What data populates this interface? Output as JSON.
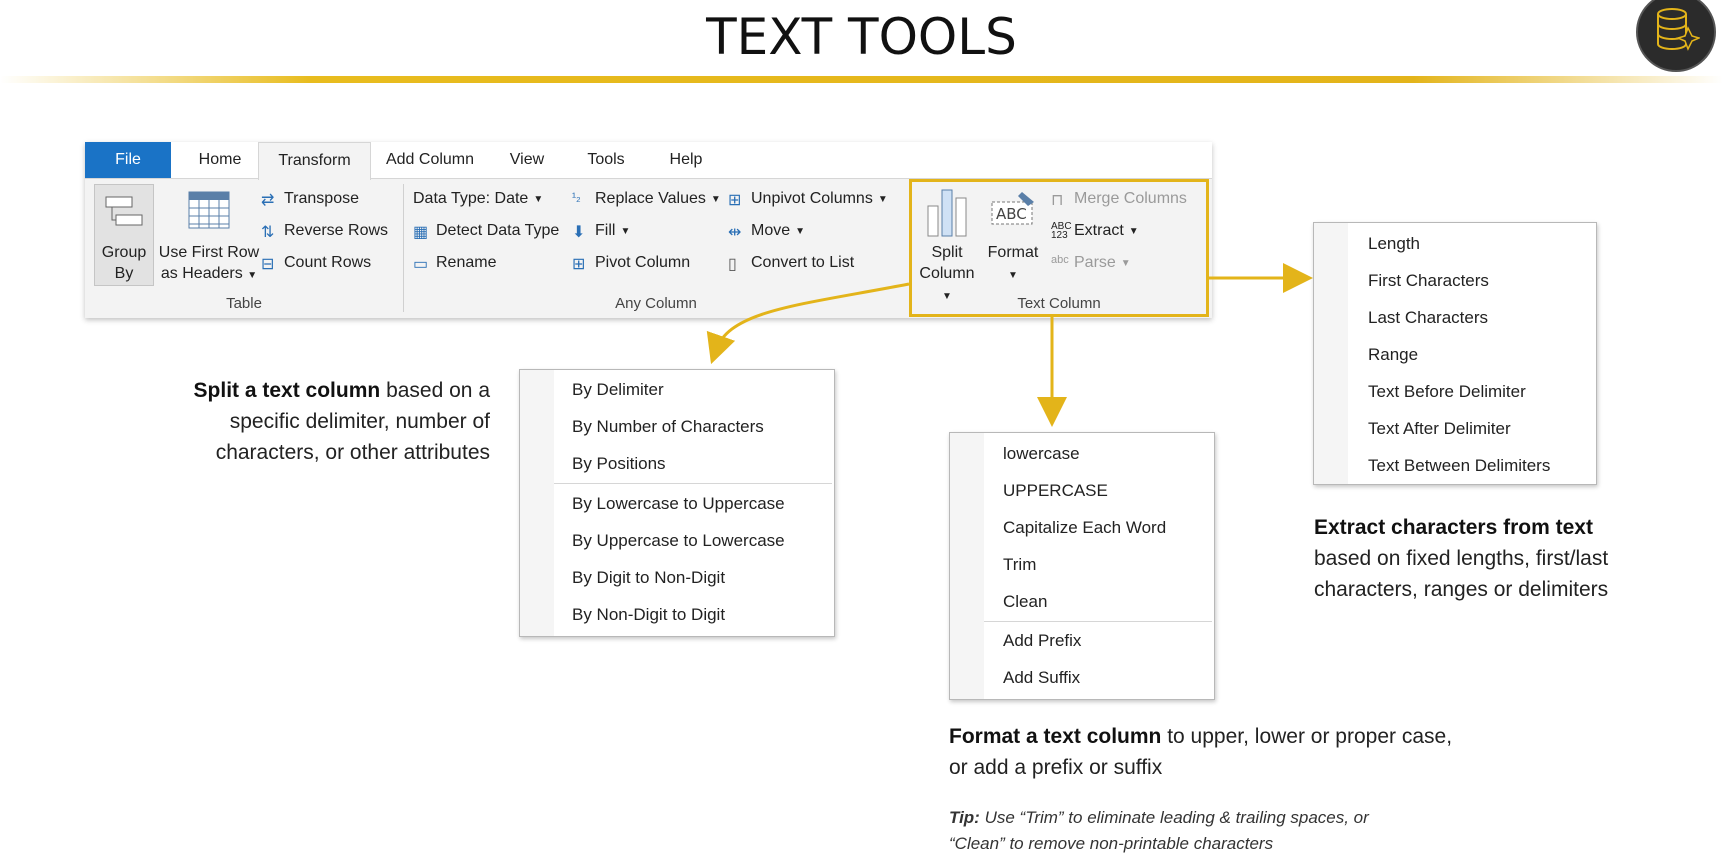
{
  "page": {
    "title": "TEXT TOOLS"
  },
  "ribbon": {
    "tabs": [
      "File",
      "Home",
      "Transform",
      "Add Column",
      "View",
      "Tools",
      "Help"
    ],
    "active_tab": "Transform",
    "table_group": {
      "label": "Table",
      "group_by": [
        "Group",
        "By"
      ],
      "use_first_row": [
        "Use First Row",
        "as Headers"
      ],
      "transpose": "Transpose",
      "reverse_rows": "Reverse Rows",
      "count_rows": "Count Rows"
    },
    "any_column_group": {
      "label": "Any Column",
      "data_type": "Data Type: Date",
      "detect_data_type": "Detect Data Type",
      "rename": "Rename",
      "replace_values": "Replace Values",
      "fill": "Fill",
      "pivot_column": "Pivot Column",
      "unpivot_columns": "Unpivot Columns",
      "move": "Move",
      "convert_to_list": "Convert to List"
    },
    "text_column_group": {
      "label": "Text Column",
      "split_column": [
        "Split",
        "Column"
      ],
      "format": "Format",
      "merge_columns": "Merge Columns",
      "extract": "Extract",
      "parse": "Parse"
    }
  },
  "split_menu": {
    "items_top": [
      "By Delimiter",
      "By Number of Characters",
      "By Positions"
    ],
    "items_bottom": [
      "By Lowercase to Uppercase",
      "By Uppercase to Lowercase",
      "By Digit to Non-Digit",
      "By Non-Digit to Digit"
    ]
  },
  "format_menu": {
    "items_top": [
      "lowercase",
      "UPPERCASE",
      "Capitalize Each Word",
      "Trim",
      "Clean"
    ],
    "items_bottom": [
      "Add Prefix",
      "Add Suffix"
    ]
  },
  "extract_menu": {
    "items": [
      "Length",
      "First Characters",
      "Last Characters",
      "Range",
      "Text Before Delimiter",
      "Text After Delimiter",
      "Text Between Delimiters"
    ]
  },
  "descriptions": {
    "split": {
      "bold": "Split a text column",
      "line1": " based on a",
      "line2": "specific delimiter, number of",
      "line3": "characters, or other attributes"
    },
    "extract": {
      "bold": "Extract characters from text",
      "line2": "based on fixed lengths, first/last",
      "line3": "characters, ranges or delimiters"
    },
    "format": {
      "bold": "Format a text column",
      "line1": " to upper, lower or proper case,",
      "line2": "or add a prefix or suffix"
    },
    "tip": {
      "bold": "Tip:",
      "line1": " Use “Trim” to eliminate leading & trailing spaces, or",
      "line2": "“Clean” to remove non-printable characters"
    }
  },
  "colors": {
    "accent": "#e3b41a",
    "file_tab": "#1a73c6"
  }
}
